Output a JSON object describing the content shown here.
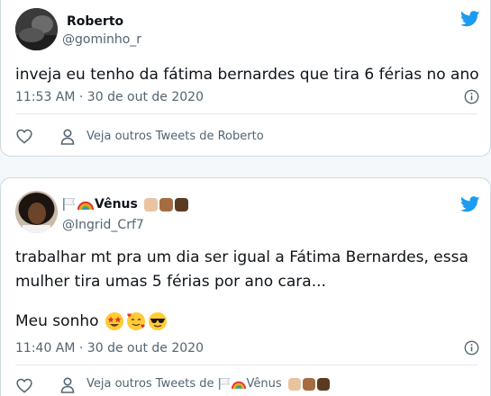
{
  "tweets": [
    {
      "name": "Roberto",
      "handle": "@gominho_r",
      "text_lines": [
        "inveja eu tenho da fátima bernardes que tira 6 férias no ano"
      ],
      "timestamp": "11:53 AM · 30 de out de 2020",
      "more_tweets": "Veja outros Tweets de Roberto"
    },
    {
      "name": "Vênus",
      "handle": "@Ingrid_Crf7",
      "text_lines": [
        "trabalhar mt pra um dia ser igual a Fátima Bernardes, essa",
        "mulher tira umas 5 férias por ano cara...",
        "Meu sonho"
      ],
      "timestamp": "11:40 AM · 30 de out de 2020",
      "more_tweets_prefix": "Veja outros Tweets de",
      "more_tweets_name": "Vênus"
    }
  ],
  "colors": {
    "twitter_blue": "#1d9bf0",
    "secondary_text": "#536471",
    "primary_text": "#0f1419",
    "border": "#cfd9de"
  },
  "icons": [
    "twitter-bird-icon",
    "info-icon",
    "heart-icon",
    "person-icon",
    "white-flag-icon",
    "rainbow-icon",
    "raised-fist-icon",
    "star-struck-icon",
    "smiling-hearts-icon",
    "sunglasses-icon"
  ]
}
